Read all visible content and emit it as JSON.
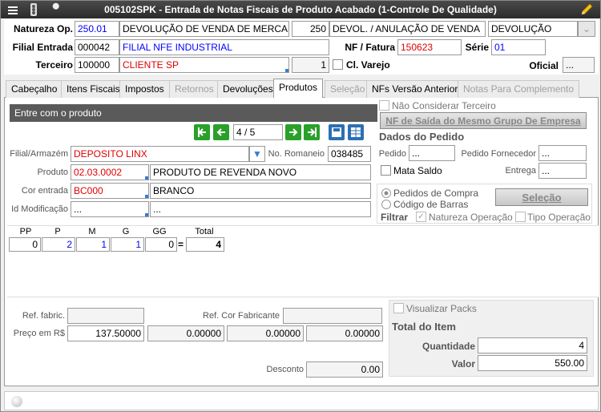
{
  "title": "005102SPK - Entrada de Notas Fiscais de Produto Acabado (1-Controle De Qualidade)",
  "header": {
    "natureza_label": "Natureza Op.",
    "natureza_code": "250.01",
    "natureza_desc": "DEVOLUÇÃO DE VENDA DE MERCADORIA",
    "natureza_num": "250",
    "natureza_desc2": "DEVOL. / ANULAÇÃO DE VENDA",
    "tipo": "DEVOLUÇÃO",
    "filial_label": "Filial Entrada",
    "filial_code": "000042",
    "filial_name": "FILIAL NFE INDUSTRIAL",
    "nf_label": "NF / Fatura",
    "nf_value": "150623",
    "serie_label": "Série",
    "serie_value": "01",
    "terceiro_label": "Terceiro",
    "terceiro_code": "100000",
    "terceiro_name": "CLIENTE SP",
    "terceiro_num": "1",
    "cl_varejo_label": "Cl. Varejo",
    "oficial_label": "Oficial",
    "oficial_value": "..."
  },
  "tabs": [
    {
      "label": "Cabeçalho",
      "state": "normal"
    },
    {
      "label": "Itens Fiscais",
      "state": "normal"
    },
    {
      "label": "Impostos",
      "state": "normal"
    },
    {
      "label": "Retornos",
      "state": "disabled"
    },
    {
      "label": "Devoluções",
      "state": "normal"
    },
    {
      "label": "Produtos",
      "state": "active"
    },
    {
      "label": "Seleção",
      "state": "disabled"
    },
    {
      "label": "NFs Versão Anterior",
      "state": "normal"
    },
    {
      "label": "Notas Para Complemento",
      "state": "disabled"
    }
  ],
  "produto": {
    "panel_title": "Entre com o produto",
    "record_pos": "4 / 5",
    "filial_label": "Filial/Armazém",
    "filial_value": "DEPOSITO LINX",
    "romaneio_label": "No. Romaneio",
    "romaneio_value": "038485",
    "produto_label": "Produto",
    "produto_code": "02.03.0002",
    "produto_desc": "PRODUTO DE REVENDA NOVO",
    "cor_label": "Cor entrada",
    "cor_code": "BC000",
    "cor_desc": "BRANCO",
    "id_label": "Id Modificação",
    "id_value": "...",
    "id_value2": "..."
  },
  "right": {
    "nao_considerar": "Não Considerar Terceiro",
    "nf_saida_btn": "NF de Saída do Mesmo Grupo De Empresa",
    "dados_pedido": "Dados do Pedido",
    "pedido_label": "Pedido",
    "pedido_value": "...",
    "pedido_forn_label": "Pedido Fornecedor",
    "pedido_forn_value": "...",
    "mata_saldo": "Mata Saldo",
    "entrega_label": "Entrega",
    "entrega_value": "...",
    "radio_pedidos": "Pedidos de Compra",
    "radio_codigo": "Código de Barras",
    "selecao_btn": "Seleção",
    "filtrar_label": "Filtrar",
    "natureza_op_chk": "Natureza Operação",
    "tipo_op_chk": "Tipo Operação"
  },
  "grade": {
    "headers": [
      "PP",
      "P",
      "M",
      "G",
      "GG",
      "Total"
    ],
    "values": [
      "0",
      "2",
      "1",
      "1",
      "0",
      "4"
    ]
  },
  "bottom": {
    "ref_fabric_label": "Ref. fabric.",
    "ref_fabric_value": "",
    "ref_cor_label": "Ref. Cor Fabricante",
    "ref_cor_value": "",
    "preco_label": "Preço em R$",
    "precos": [
      "137.50000",
      "0.00000",
      "0.00000",
      "0.00000"
    ],
    "desconto_label": "Desconto",
    "desconto_value": "0.00",
    "visualizar_packs": "Visualizar Packs",
    "total_item": "Total do Item",
    "quantidade_label": "Quantidade",
    "quantidade_value": "4",
    "valor_label": "Valor",
    "valor_value": "550.00"
  }
}
